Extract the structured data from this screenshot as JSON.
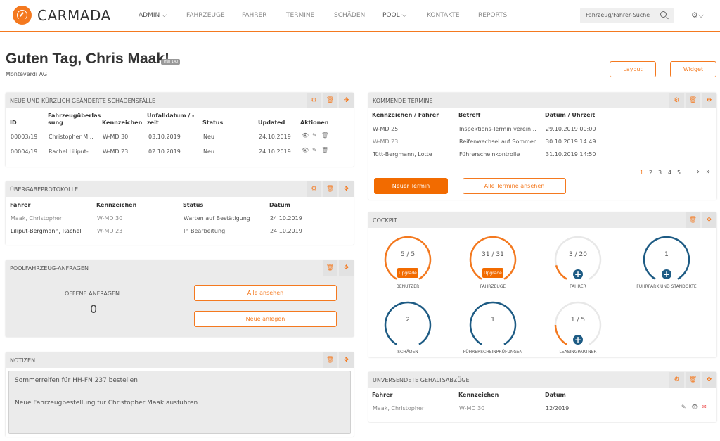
{
  "app": {
    "brand": "CARMADA",
    "accent_color": "#f4791f",
    "dark_blue": "#1d5b84"
  },
  "nav": {
    "items": [
      {
        "label": "ADMIN",
        "dropdown": true
      },
      {
        "label": "FAHRZEUGE"
      },
      {
        "label": "FAHRER"
      },
      {
        "label": "TERMINE"
      },
      {
        "label": "SCHÄDEN"
      },
      {
        "label": "POOL",
        "dropdown": true
      },
      {
        "label": "KONTAKTE"
      },
      {
        "label": "REPORTS"
      }
    ],
    "search_placeholder": "Fahrzeug/Fahrer-Suche",
    "chevron": "⌵",
    "gear": "⚙"
  },
  "header": {
    "greeting": "Guten Tag, Chris Maak!",
    "badge": "Trial 140",
    "company": "Monteverdi AG",
    "layout_btn": "Layout",
    "widget_btn": "Widget"
  },
  "icons": {
    "gear": "⚙",
    "trash": "🗑",
    "move": "✥",
    "eye": "👁",
    "pencil": "✎",
    "mail": "✉"
  },
  "schaden": {
    "title": "NEUE UND KÜRZLICH GEÄNDERTE SCHADENSFÄLLE",
    "headers": [
      "ID",
      "Fahrzeugüberlas sung",
      "Kennzeichen",
      "Unfalldatum / - zeit",
      "Status",
      "Updated",
      "Aktionen"
    ],
    "rows": [
      [
        "00003/19",
        "Christopher M...",
        "W-MD 30",
        "03.10.2019",
        "Neu",
        "24.10.2019"
      ],
      [
        "00004/19",
        "Rachel Liliput-...",
        "W-MD 23",
        "02.10.2019",
        "Neu",
        "24.10.2019"
      ]
    ]
  },
  "uebergabe": {
    "title": "ÜBERGABEPROTOKOLLE",
    "headers": [
      "Fahrer",
      "Kennzeichen",
      "Status",
      "Datum"
    ],
    "rows": [
      [
        "Maak, Christopher",
        "W-MD 30",
        "Warten auf Bestätigung",
        "24.10.2019"
      ],
      [
        "Liliput-Bergmann, Rachel",
        "W-MD 23",
        "In Bearbeitung",
        "24.10.2019"
      ]
    ]
  },
  "pool": {
    "title": "POOLFAHRZEUG-ANFRAGEN",
    "open_label": "OFFENE ANFRAGEN",
    "open_count": "0",
    "view_all": "Alle ansehen",
    "create_new": "Neue anlegen"
  },
  "notizen": {
    "title": "NOTIZEN",
    "lines": [
      "Sommerreifen für HH-FN 237 bestellen",
      "Neue Fahrzeugbestellung für Christopher Maak ausführen"
    ]
  },
  "termine": {
    "title": "KOMMENDE TERMINE",
    "headers": [
      "Kennzeichen / Fahrer",
      "Betreff",
      "Datum / Uhrzeit"
    ],
    "rows": [
      [
        "W-MD 25",
        "Inspektions-Termin verein...",
        "29.10.2019 00:00"
      ],
      [
        "W-MD 23",
        "Reifenwechsel auf Sommer",
        "30.10.2019 14:49"
      ],
      [
        "Tütt-Bergmann, Lotte",
        "Führerscheinkontrolle",
        "31.10.2019 14:50"
      ]
    ],
    "pages": [
      "1",
      "2",
      "3",
      "4",
      "5",
      "...",
      "›",
      "»"
    ],
    "current_page": "1",
    "new_btn": "Neuer Termin",
    "all_btn": "Alle Termine ansehen"
  },
  "cockpit": {
    "title": "COCKPIT",
    "gauges": [
      {
        "label": "BENUTZER",
        "value": "5 / 5",
        "fraction": 1.0,
        "color": "#f4791f",
        "action": "upgrade",
        "action_label": "Upgrade"
      },
      {
        "label": "FAHRZEUGE",
        "value": "31 / 31",
        "fraction": 1.0,
        "color": "#f4791f",
        "action": "upgrade",
        "action_label": "Upgrade"
      },
      {
        "label": "FAHRER",
        "value": "3 / 20",
        "fraction": 0.15,
        "color": "#f4791f",
        "action": "plus"
      },
      {
        "label": "FUHRPARK UND STANDORTE",
        "value": "1",
        "fraction": 1.0,
        "color": "#1d5b84",
        "action": "plus"
      },
      {
        "label": "SCHÄDEN",
        "value": "2",
        "fraction": 1.0,
        "color": "#1d5b84",
        "action": "none"
      },
      {
        "label": "FÜHRERSCHEINPRÜFUNGEN",
        "value": "1",
        "fraction": 1.0,
        "color": "#1d5b84",
        "action": "none"
      },
      {
        "label": "LEASINGPARTNER",
        "value": "1 / 5",
        "fraction": 0.2,
        "color": "#f4791f",
        "action": "plus"
      }
    ]
  },
  "gehalt": {
    "title": "UNVERSENDETE GEHALTSABZÜGE",
    "headers": [
      "Fahrer",
      "Kennzeichen",
      "Datum"
    ],
    "rows": [
      [
        "Maak, Christopher",
        "W-MD 30",
        "12/2019"
      ]
    ]
  }
}
